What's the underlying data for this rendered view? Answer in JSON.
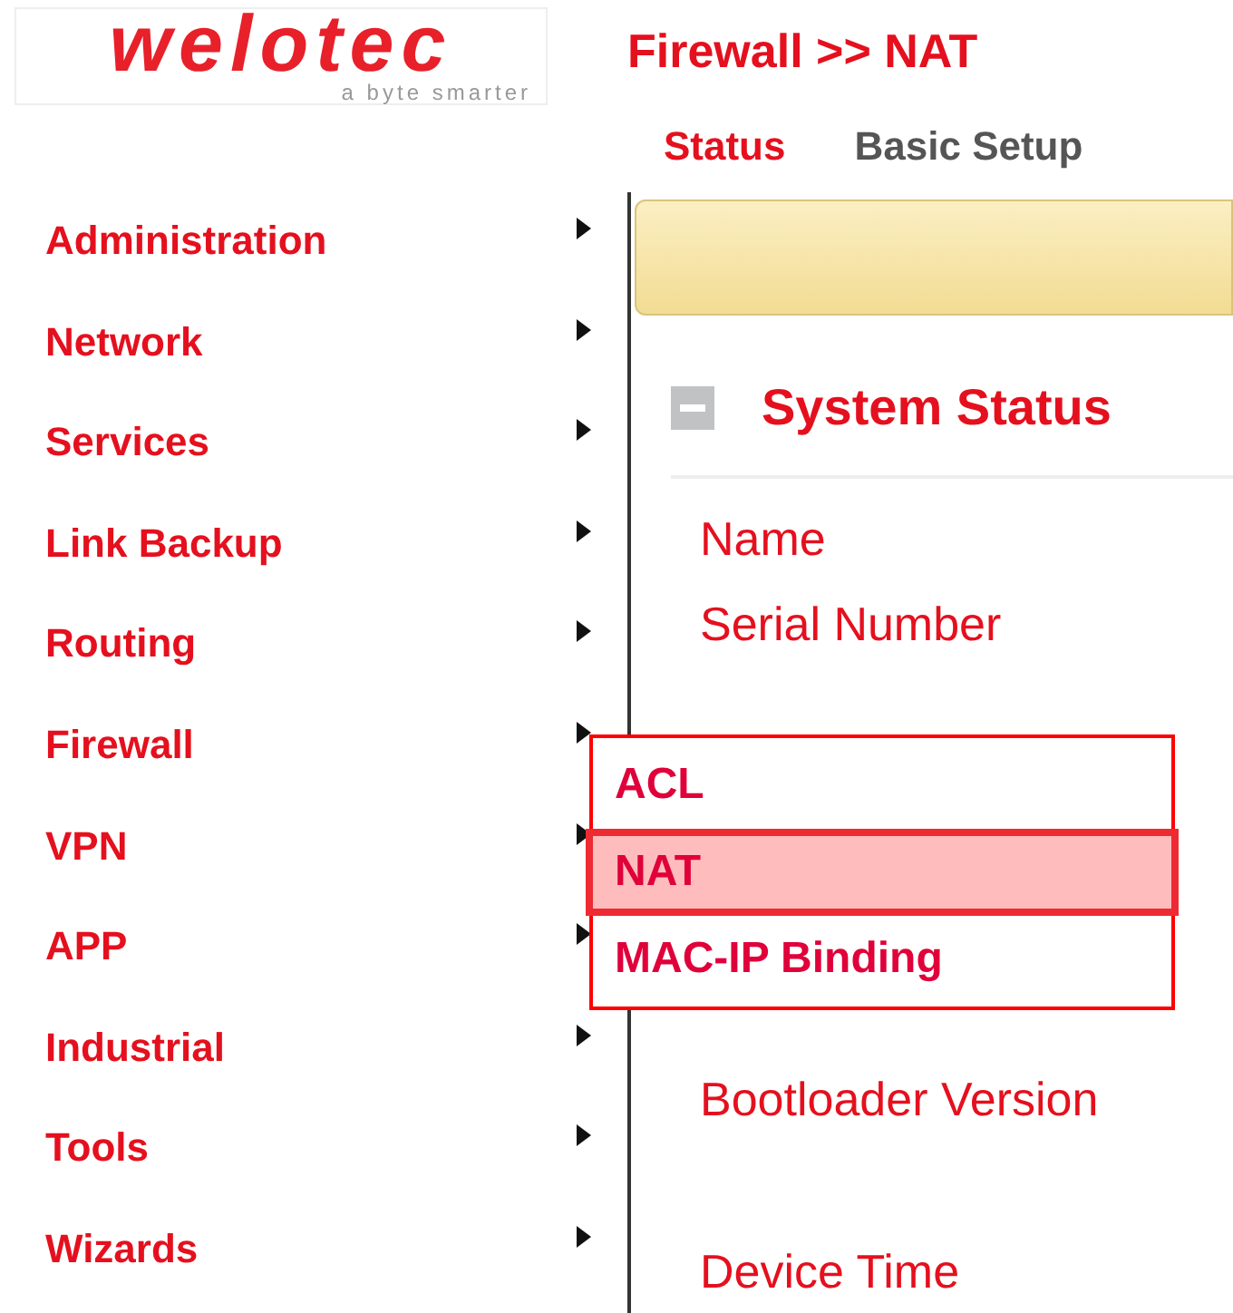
{
  "logo": {
    "brand": "welotec",
    "tagline": "a byte smarter"
  },
  "breadcrumb": "Firewall >> NAT",
  "tabs": [
    {
      "label": "Status",
      "selected": true
    },
    {
      "label": "Basic Setup",
      "selected": false
    }
  ],
  "sidebar": {
    "items": [
      {
        "label": "Administration"
      },
      {
        "label": "Network"
      },
      {
        "label": "Services"
      },
      {
        "label": "Link Backup"
      },
      {
        "label": "Routing"
      },
      {
        "label": "Firewall"
      },
      {
        "label": "VPN"
      },
      {
        "label": "APP"
      },
      {
        "label": "Industrial"
      },
      {
        "label": "Tools"
      },
      {
        "label": "Wizards"
      }
    ]
  },
  "submenu": {
    "items": [
      {
        "label": "ACL",
        "selected": false
      },
      {
        "label": "NAT",
        "selected": true
      },
      {
        "label": "MAC-IP Binding",
        "selected": false
      }
    ]
  },
  "section": {
    "title": "System Status",
    "expanded": true,
    "fields": [
      {
        "label": "Name"
      },
      {
        "label": "Serial Number"
      },
      {
        "label": "Bootloader Version"
      },
      {
        "label": "Device Time",
        "gap": true
      }
    ]
  }
}
